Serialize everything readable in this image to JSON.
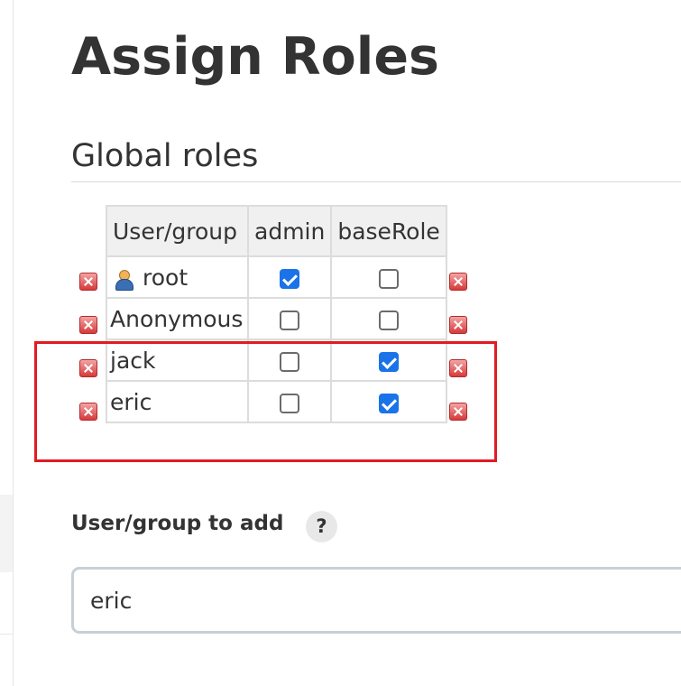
{
  "page": {
    "title": "Assign Roles"
  },
  "global_roles": {
    "section_title": "Global roles",
    "columns": [
      "User/group",
      "admin",
      "baseRole"
    ],
    "rows": [
      {
        "name": "root",
        "icon": "user-icon",
        "admin": true,
        "baseRole": false
      },
      {
        "name": "Anonymous",
        "icon": null,
        "admin": false,
        "baseRole": false
      },
      {
        "name": "jack",
        "icon": null,
        "admin": false,
        "baseRole": true
      },
      {
        "name": "eric",
        "icon": null,
        "admin": false,
        "baseRole": true
      }
    ]
  },
  "add_user": {
    "label": "User/group to add",
    "help_symbol": "?",
    "value": "eric"
  },
  "colors": {
    "checkbox_checked": "#1a73e8",
    "highlight_border": "#e11b22",
    "delete_icon": "#d63a3a"
  }
}
